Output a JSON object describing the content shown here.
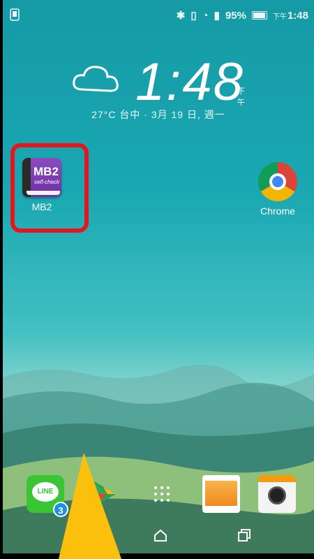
{
  "status_bar": {
    "battery": "95%",
    "time_prefix": "下午",
    "time": "1:48"
  },
  "clock_widget": {
    "time": "1:48",
    "ampm": "下午",
    "weather_date": "27°C 台中 · 3月 19 日, 週一",
    "weather_icon": "cloud-icon"
  },
  "apps": [
    {
      "label": "MB2",
      "icon": "mb2-book-icon",
      "icon_text": "MB2",
      "icon_subtext": "self-check"
    },
    {
      "label": "Chrome",
      "icon": "chrome-icon"
    }
  ],
  "dock": [
    {
      "icon": "line-icon",
      "icon_text": "LINE",
      "badge": "3"
    },
    {
      "icon": "play-store-icon"
    },
    {
      "icon": "app-drawer-icon"
    },
    {
      "icon": "gallery-icon"
    },
    {
      "icon": "camera-icon"
    }
  ],
  "colors": {
    "highlight": "#e8141b",
    "arrow": "#fbbf0e"
  }
}
